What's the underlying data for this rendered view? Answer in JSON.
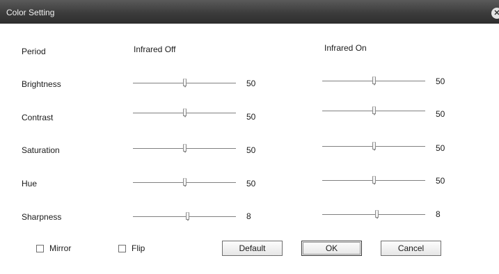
{
  "window": {
    "title": "Color Setting",
    "close_glyph": "✕"
  },
  "headers": {
    "period": "Period",
    "infrared_off": "Infrared Off",
    "infrared_on": "Infrared On"
  },
  "rows": [
    {
      "label": "Brightness",
      "off_value": "50",
      "on_value": "50",
      "off_level": 50,
      "on_level": 50
    },
    {
      "label": "Contrast",
      "off_value": "50",
      "on_value": "50",
      "off_level": 50,
      "on_level": 50
    },
    {
      "label": "Saturation",
      "off_value": "50",
      "on_value": "50",
      "off_level": 50,
      "on_level": 50
    },
    {
      "label": "Hue",
      "off_value": "50",
      "on_value": "50",
      "off_level": 50,
      "on_level": 50
    },
    {
      "label": "Sharpness",
      "off_value": "8",
      "on_value": "8",
      "off_level": 8,
      "on_level": 8
    }
  ],
  "checkboxes": {
    "mirror": {
      "label": "Mirror",
      "checked": false
    },
    "flip": {
      "label": "Flip",
      "checked": false
    }
  },
  "buttons": {
    "default": "Default",
    "ok": "OK",
    "cancel": "Cancel"
  }
}
